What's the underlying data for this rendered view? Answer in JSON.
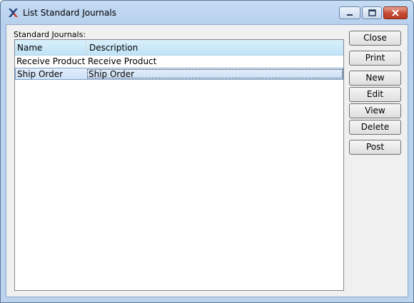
{
  "window": {
    "title": "List Standard Journals",
    "icon": "xtuple-x-icon"
  },
  "list": {
    "label": "Standard Journals:",
    "columns": [
      "Name",
      "Description"
    ],
    "rows": [
      {
        "name": "Receive Product",
        "description": "Receive Product",
        "selected": false
      },
      {
        "name": "Ship Order",
        "description": "Ship Order",
        "selected": true
      }
    ]
  },
  "buttons": {
    "close": "Close",
    "print": "Print",
    "new": "New",
    "edit": "Edit",
    "view": "View",
    "delete": "Delete",
    "post": "Post"
  },
  "colors": {
    "header_bg": "#c8e8f8",
    "selection_bg": "#cce0f6",
    "close_btn": "#c64a32"
  }
}
